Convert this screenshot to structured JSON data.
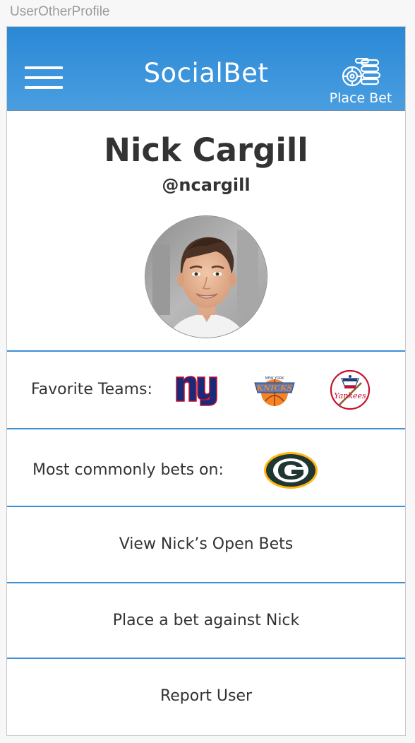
{
  "window": {
    "title": "UserOtherProfile"
  },
  "header": {
    "app_title": "SocialBet",
    "menu_icon": "hamburger-menu-icon",
    "place_bet_icon": "casino-chips-icon",
    "place_bet_label": "Place Bet",
    "background_color": "#2a88d6"
  },
  "profile": {
    "name": "Nick Cargill",
    "handle": "@ncargill",
    "avatar_icon": "profile-photo"
  },
  "favorite_teams": {
    "label": "Favorite Teams:",
    "teams": [
      {
        "icon": "new-york-giants-logo",
        "text": "ny",
        "color": "#1a2a7a"
      },
      {
        "icon": "new-york-knicks-logo",
        "text": "KNICKS",
        "color": "#f58426"
      },
      {
        "icon": "new-york-yankees-logo",
        "text": "Yankees",
        "color": "#c8102e"
      }
    ]
  },
  "common_bets": {
    "label": "Most commonly bets on:",
    "team": {
      "icon": "green-bay-packers-logo",
      "text": "G",
      "color": "#203731",
      "accent": "#ffb612"
    }
  },
  "actions": {
    "open_bets": "View Nick’s Open Bets",
    "bet_against": "Place a bet against Nick",
    "report": "Report User"
  },
  "theme": {
    "divider_color": "#3c8fd6",
    "text_color": "#333333"
  }
}
